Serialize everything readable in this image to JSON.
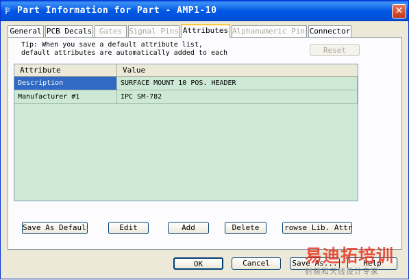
{
  "window": {
    "title": "Part Information for Part - AMP1-10",
    "close_glyph": "✕",
    "icon_glyph": "ℙ"
  },
  "tabs": [
    {
      "label": "General",
      "state": "enabled"
    },
    {
      "label": "PCB Decals",
      "state": "enabled"
    },
    {
      "label": "Gates",
      "state": "disabled"
    },
    {
      "label": "Signal Pins",
      "state": "disabled"
    },
    {
      "label": "Attributes",
      "state": "active"
    },
    {
      "label": "Alphanumeric Pins",
      "state": "disabled"
    },
    {
      "label": "Connector",
      "state": "enabled"
    }
  ],
  "tip": "Tip: When you save a default attribute list,\ndefault attributes are automatically added to each",
  "reset_label": "Reset",
  "grid": {
    "columns": [
      "Attribute",
      "Value"
    ],
    "rows": [
      {
        "attribute": "Description",
        "value": "SURFACE MOUNT 10 POS. HEADER",
        "selected": true
      },
      {
        "attribute": "Manufacturer #1",
        "value": "IPC SM-782",
        "selected": false
      }
    ]
  },
  "actions": {
    "save_as_default": "Save As Default",
    "edit": "Edit",
    "add": "Add",
    "delete": "Delete",
    "browse": "rowse Lib. Attr.."
  },
  "footer": {
    "ok": "OK",
    "cancel": "Cancel",
    "save_as": "Save As...",
    "help": "Help"
  },
  "watermark": {
    "main": "易迪拓培训",
    "sub": "射频和天线设计专家"
  },
  "colors": {
    "titlebar": "#0058e6",
    "grid_bg": "#cde8d4",
    "selection": "#316ac5",
    "active_tab_accent": "#ffc83c"
  }
}
